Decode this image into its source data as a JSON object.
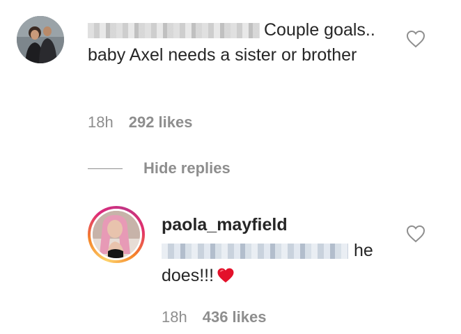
{
  "comment": {
    "avatar_alt": "commenter-avatar",
    "text": "Couple goals.. baby Axel needs a sister or brother",
    "time": "18h",
    "likes": "292 likes",
    "like_icon": "heart-outline-icon"
  },
  "replies_toggle": {
    "label": "Hide replies"
  },
  "reply": {
    "username": "paola_mayfield",
    "text": "he does!!!",
    "emoji": "red-heart-emoji",
    "time": "18h",
    "likes": "436 likes",
    "like_icon": "heart-outline-icon",
    "story_ring_colors": [
      "#fdd26b",
      "#f58529",
      "#dd2a7b",
      "#c13584"
    ]
  }
}
